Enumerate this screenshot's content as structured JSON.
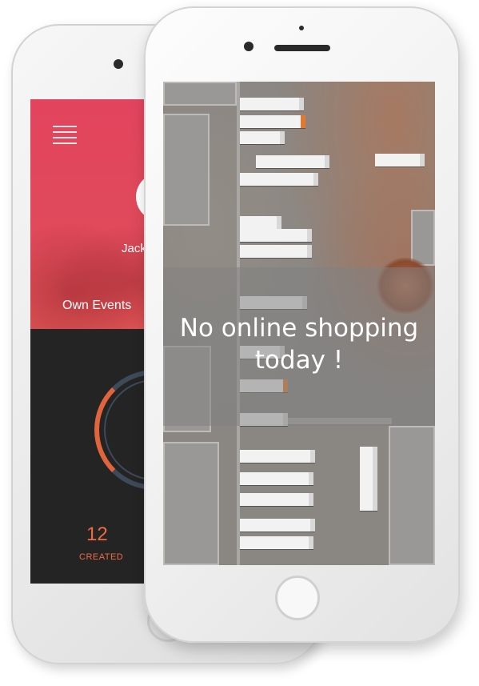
{
  "back_app": {
    "user_name": "Jack",
    "tab_label": "Own Events",
    "stat": {
      "value": "12",
      "label": "CREATED"
    },
    "colors": {
      "header": "#e2445e",
      "accent": "#f06a43",
      "ring": "#3d4a5a",
      "background": "#242424"
    }
  },
  "front_app": {
    "headline_line1": "No online shopping",
    "headline_line2": "today !",
    "background_image": "aerial-warehouse-trucks-photo"
  },
  "icons": [
    "menu-icon",
    "avatar-icon",
    "camera-icon",
    "home-button-icon"
  ]
}
